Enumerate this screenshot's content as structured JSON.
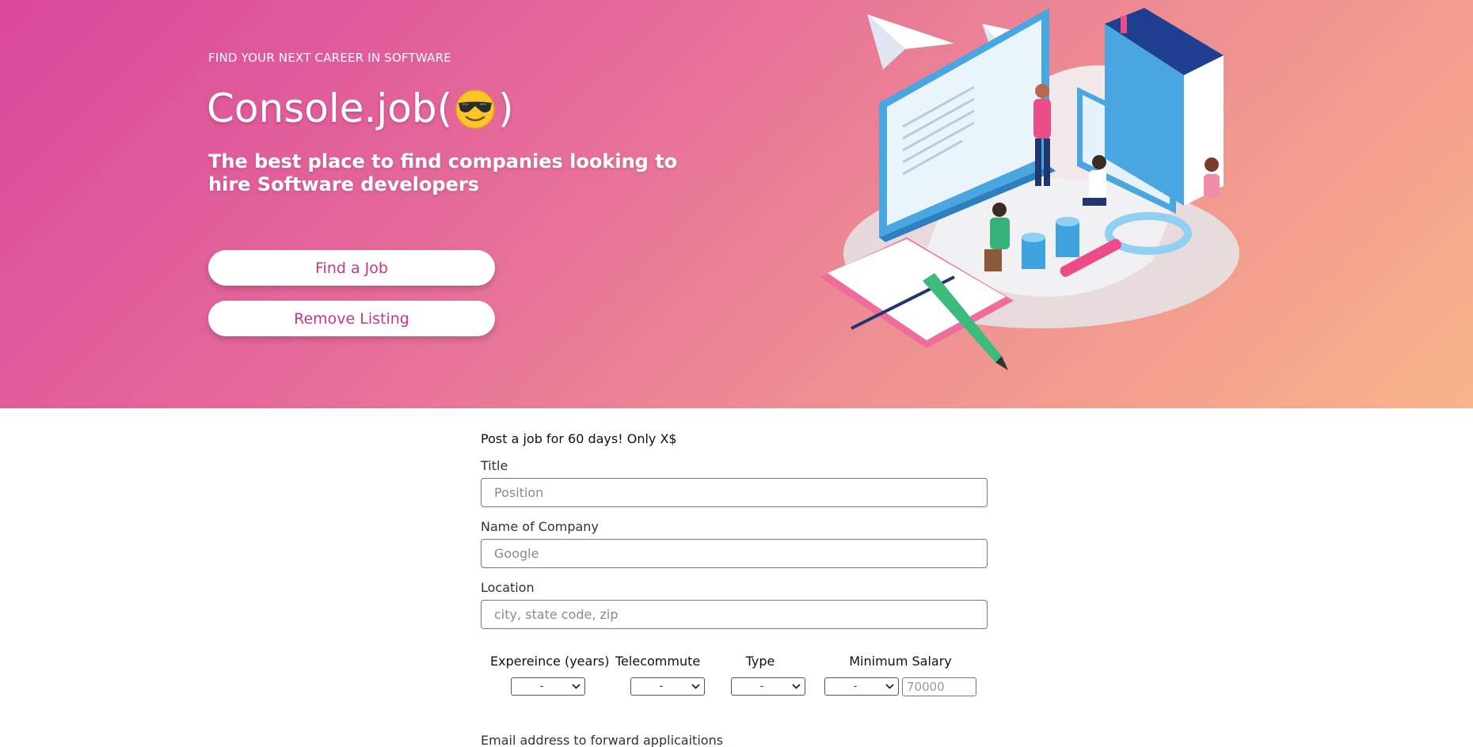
{
  "hero": {
    "eyebrow": "FIND YOUR NEXT CAREER IN SOFTWARE",
    "brand_prefix": "Console.job(",
    "brand_suffix": ")",
    "brand_emoji": "sunglasses-face-icon",
    "tagline": "The best place to find companies looking to hire Software developers",
    "find_job_label": "Find a Job",
    "remove_listing_label": "Remove Listing"
  },
  "form": {
    "heading": "Post a job for 60 days! Only X$",
    "title_label": "Title",
    "title_placeholder": "Position",
    "company_label": "Name of Company",
    "company_placeholder": "Google",
    "location_label": "Location",
    "location_placeholder": "city, state code, zip",
    "experience_label": "Expereince (years)",
    "experience_value": "-",
    "telecommute_label": "Telecommute",
    "telecommute_value": "-",
    "type_label": "Type",
    "type_value": "-",
    "salary_label": "Minimum Salary",
    "salary_currency_value": "-",
    "salary_placeholder": "70000",
    "email_label": "Email address to forward applicaitions"
  },
  "colors": {
    "gradient_start": "#d9479c",
    "gradient_end": "#f9b48a",
    "button_text": "#c8358f"
  }
}
